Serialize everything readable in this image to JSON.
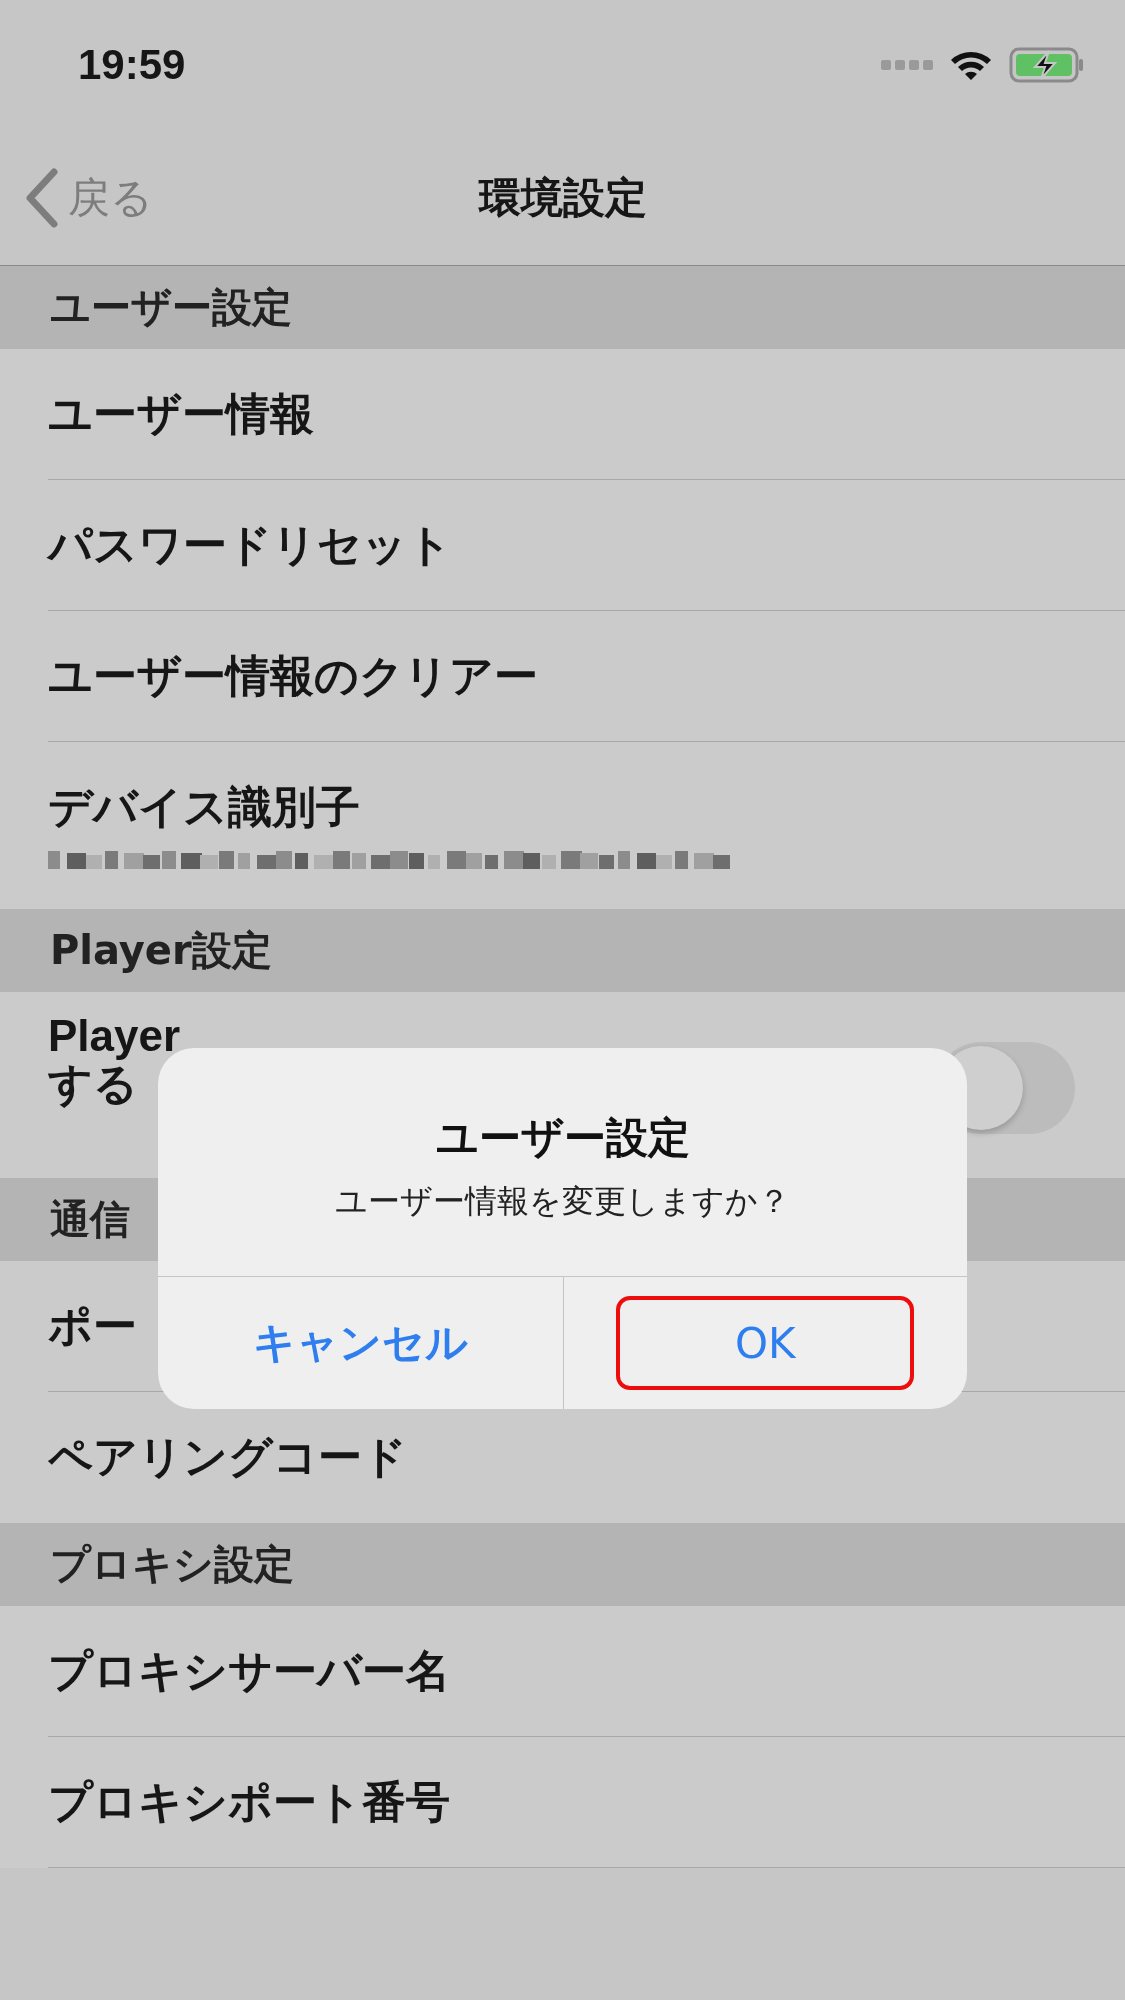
{
  "status_bar": {
    "time": "19:59"
  },
  "nav": {
    "back": "戻る",
    "title": "環境設定"
  },
  "sections": [
    {
      "header": "ユーザー設定",
      "rows": [
        {
          "kind": "item",
          "label": "ユーザー情報"
        },
        {
          "kind": "item",
          "label": "パスワードリセット"
        },
        {
          "kind": "item",
          "label": "ユーザー情報のクリアー"
        },
        {
          "kind": "redacted",
          "label": "デバイス識別子"
        }
      ]
    },
    {
      "header": "Player設定",
      "rows": [
        {
          "kind": "toggle",
          "label_lines": [
            "Player",
            "する"
          ],
          "on": false
        }
      ]
    },
    {
      "header": "通信",
      "rows": [
        {
          "kind": "item",
          "label": "ポー"
        },
        {
          "kind": "item",
          "label": "ペアリングコード"
        }
      ]
    },
    {
      "header": "プロキシ設定",
      "rows": [
        {
          "kind": "item",
          "label": "プロキシサーバー名"
        },
        {
          "kind": "item",
          "label": "プロキシポート番号"
        }
      ]
    }
  ],
  "alert": {
    "title": "ユーザー設定",
    "message": "ユーザー情報を変更しますか？",
    "buttons": [
      {
        "label": "キャンセル",
        "bold": true,
        "highlighted": false
      },
      {
        "label": "OK",
        "bold": false,
        "highlighted": true
      }
    ]
  }
}
